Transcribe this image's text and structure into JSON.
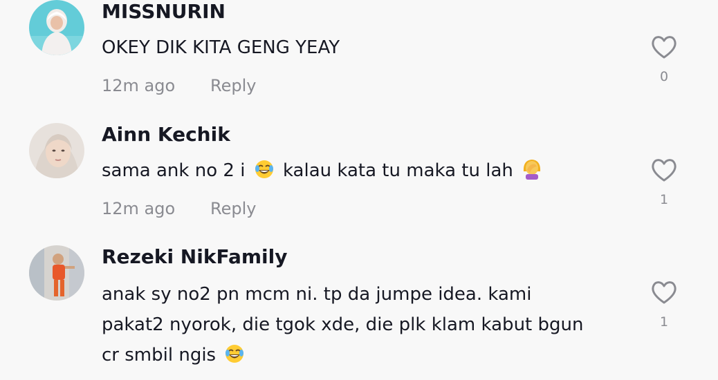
{
  "comments": [
    {
      "username": "MISSNURIN",
      "text_lines": [
        "OKEY DIK KITA GENG YEAY"
      ],
      "time": "12m ago",
      "reply_label": "Reply",
      "likes": "0",
      "avatar": "avatar-missnurin"
    },
    {
      "username": "Ainn Kechik",
      "text_parts": [
        "sama ank no 2 i",
        "kalau kata tu maka tu lah"
      ],
      "time": "12m ago",
      "reply_label": "Reply",
      "likes": "1",
      "avatar": "avatar-ainn-kechik"
    },
    {
      "username": "Rezeki NikFamily",
      "text_lines": [
        "anak sy no2 pn mcm ni. tp da jumpe idea. kami",
        "pakat2 nyorok, die tgok xde, die plk klam kabut bgun",
        "cr smbil ngis"
      ],
      "likes": "1",
      "avatar": "avatar-rezeki-nikfamily"
    }
  ],
  "icons": {
    "like": "heart-outline-icon",
    "laugh": "face-with-tears-of-joy-icon",
    "facepalm": "woman-facepalming-icon"
  },
  "colors": {
    "background": "#f8f8f8",
    "primary_text": "#161823",
    "secondary_text": "#8a8b91",
    "heart_stroke": "#8a8b91"
  }
}
